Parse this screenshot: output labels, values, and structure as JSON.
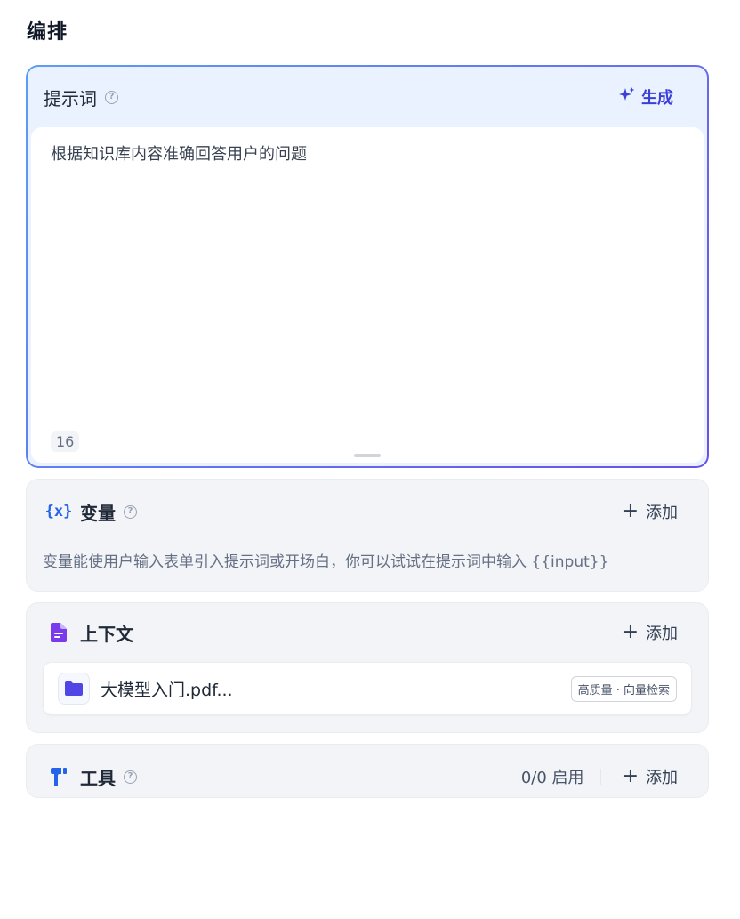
{
  "page": {
    "title": "编排"
  },
  "prompt": {
    "label": "提示词",
    "help": "?",
    "generate_label": "生成",
    "text": "根据知识库内容准确回答用户的问题",
    "char_count": "16"
  },
  "variables": {
    "icon_text": "{x}",
    "title": "变量",
    "help": "?",
    "add_label": "添加",
    "description": "变量能使用户输入表单引入提示词或开场白，你可以试试在提示词中输入 {{input}}"
  },
  "context": {
    "title": "上下文",
    "add_label": "添加",
    "files": [
      {
        "name": "大模型入门.pdf...",
        "badge": "高质量 · 向量检索"
      }
    ]
  },
  "tools": {
    "title": "工具",
    "help": "?",
    "status": "0/0 启用",
    "add_label": "添加"
  },
  "colors": {
    "accent": "#3b3fd8",
    "variables_icon": "#2563eb",
    "context_icon": "#7c3aed",
    "tools_icon": "#2563eb",
    "file_icon": "#4f46e5"
  }
}
